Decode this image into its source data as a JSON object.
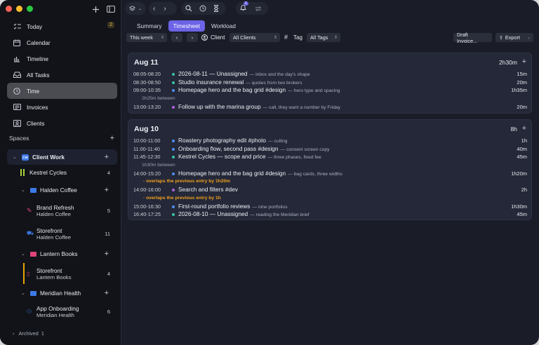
{
  "nav": [
    {
      "label": "Today",
      "icon": "checklist-icon",
      "badge": "2"
    },
    {
      "label": "Calendar",
      "icon": "calendar-icon"
    },
    {
      "label": "Timeline",
      "icon": "timeline-icon"
    },
    {
      "label": "All Tasks",
      "icon": "inbox-icon"
    },
    {
      "label": "Time",
      "icon": "clock-icon",
      "active": true
    },
    {
      "label": "Invoices",
      "icon": "invoice-icon"
    },
    {
      "label": "Clients",
      "icon": "clients-icon"
    }
  ],
  "spaces": {
    "title": "Spaces",
    "client": {
      "badge": "CW",
      "label": "Client Work"
    },
    "kestrel": {
      "label": "Kestrel Cycles",
      "count": "4"
    },
    "halden": {
      "label": "Halden Coffee",
      "color": "#3d7ae6"
    },
    "brand": {
      "label": "Brand Refresh",
      "sub": "Halden Coffee",
      "count": "5"
    },
    "storefront1": {
      "label": "Storefront",
      "sub": "Halden Coffee",
      "count": "11"
    },
    "lantern": {
      "label": "Lantern Books",
      "color": "#e0447a"
    },
    "storefront2": {
      "label": "Storefront",
      "sub": "Lantern Books",
      "count": "4"
    },
    "meridian": {
      "label": "Meridian Health",
      "color": "#3d7ae6"
    },
    "onboarding": {
      "label": "App Onboarding",
      "sub": "Meridian Health",
      "count": "6"
    },
    "archived": {
      "label": "Archived",
      "count": "1"
    }
  },
  "topbar": {
    "notif_count": "1"
  },
  "tabs": [
    "Summary",
    "Timesheet",
    "Workload"
  ],
  "active_tab": "Timesheet",
  "filters": {
    "range": "This week",
    "client_label": "Client",
    "client_value": "All Clients",
    "tag_label": "Tag",
    "tag_value": "All Tags",
    "draft_invoice": "Draft Invoice...",
    "export": "Export"
  },
  "days": [
    {
      "title": "Aug 11",
      "total": "2h30m",
      "rows": [
        {
          "type": "entry",
          "time": "08:05-08:20",
          "color": "#37c4a0",
          "title": "2026-08-11 — Unassigned",
          "note": "— inbox and the day's shape",
          "dur": "15m"
        },
        {
          "type": "entry",
          "time": "08:30-08:50",
          "color": "#37c4a0",
          "title": "Studio insurance renewal",
          "note": "— quotes from two brokers",
          "dur": "20m"
        },
        {
          "type": "entry",
          "time": "09:00-10:35",
          "color": "#4f8ef7",
          "title": "Homepage hero and the bag grid #design",
          "note": "— hero type and spacing",
          "dur": "1h35m"
        },
        {
          "type": "gap",
          "text": "2h25m between"
        },
        {
          "type": "entry",
          "time": "13:00-13:20",
          "color": "#b35fe0",
          "title": "Follow up with the marina group",
          "note": "— call, they want a number by Friday",
          "dur": "20m"
        }
      ]
    },
    {
      "title": "Aug 10",
      "total": "8h",
      "rows": [
        {
          "type": "entry",
          "time": "10:00-11:00",
          "color": "#4f8ef7",
          "title": "Roastery photography edit #photo",
          "note": "— culling",
          "dur": "1h"
        },
        {
          "type": "entry",
          "time": "11:00-11:40",
          "color": "#4f8ef7",
          "title": "Onboarding flow, second pass #design",
          "note": "— consent screen copy",
          "dur": "40m"
        },
        {
          "type": "entry",
          "time": "11:45-12:30",
          "color": "#37c4a0",
          "title": "Kestrel Cycles — scope and price",
          "note": "— three phases, fixed fee",
          "dur": "45m"
        },
        {
          "type": "gap",
          "text": "1h30m between"
        },
        {
          "type": "entry",
          "time": "14:00-15:20",
          "color": "#4f8ef7",
          "title": "Homepage hero and the bag grid #design",
          "note": "— bag cards, three widths",
          "dur": "1h20m"
        },
        {
          "type": "warn",
          "text": "· overlaps the previous entry by 1h20m"
        },
        {
          "type": "entry",
          "time": "14:00-16:00",
          "color": "#b35fe0",
          "title": "Search and filters #dev",
          "note": "",
          "dur": "2h"
        },
        {
          "type": "warn",
          "text": "· overlaps the previous entry by 1h"
        },
        {
          "type": "entry",
          "time": "15:00-16:30",
          "color": "#4f8ef7",
          "title": "First-round portfolio reviews",
          "note": "— nine portfolios",
          "dur": "1h30m"
        },
        {
          "type": "entry",
          "time": "16:40-17:25",
          "color": "#37c4a0",
          "title": "2026-08-10 — Unassigned",
          "note": "— reading the Meridian brief",
          "dur": "45m"
        }
      ]
    }
  ]
}
